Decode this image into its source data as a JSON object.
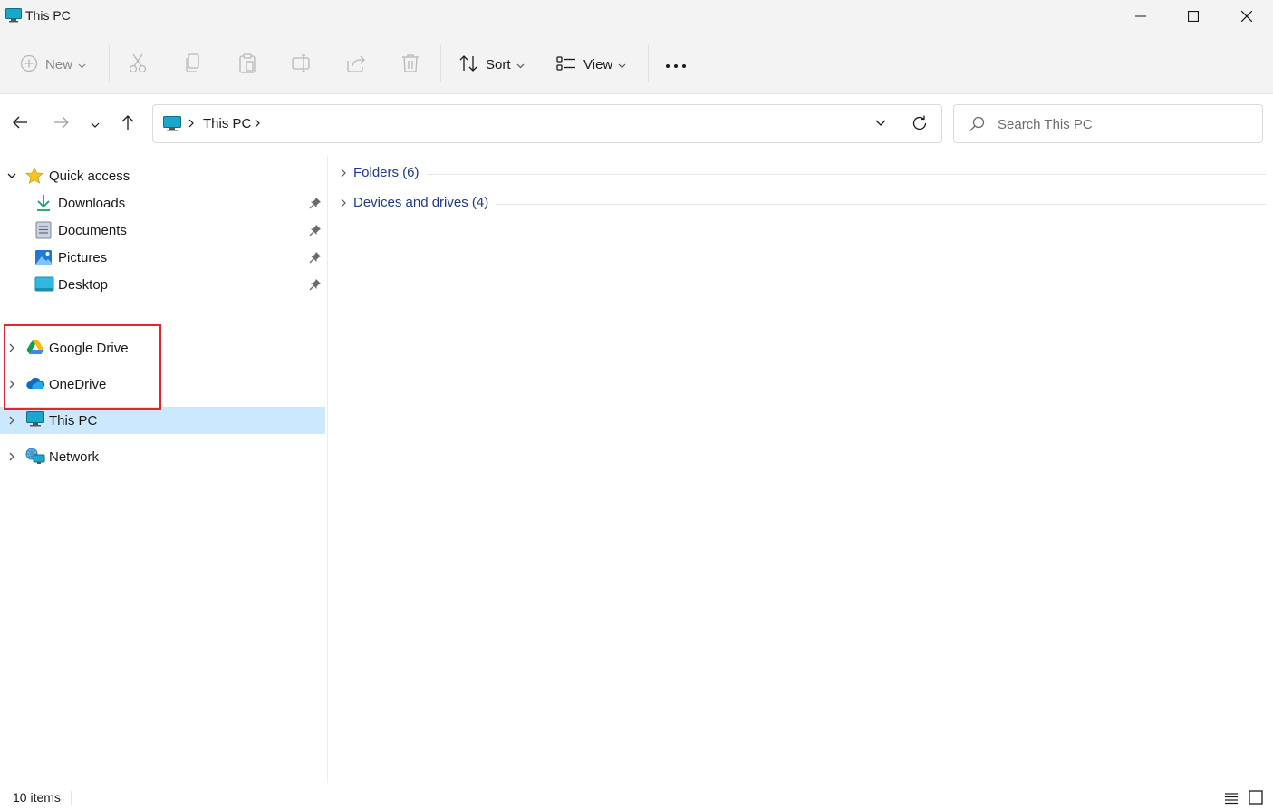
{
  "window": {
    "title": "This PC"
  },
  "toolbar": {
    "new_label": "New",
    "sort_label": "Sort",
    "view_label": "View"
  },
  "address": {
    "crumb": "This PC"
  },
  "search": {
    "placeholder": "Search This PC"
  },
  "sidebar": {
    "quick_access": "Quick access",
    "pinned": [
      {
        "label": "Downloads",
        "icon": "download-icon"
      },
      {
        "label": "Documents",
        "icon": "document-icon"
      },
      {
        "label": "Pictures",
        "icon": "pictures-icon"
      },
      {
        "label": "Desktop",
        "icon": "desktop-icon"
      }
    ],
    "google_drive": "Google Drive",
    "onedrive": "OneDrive",
    "this_pc": "This PC",
    "network": "Network"
  },
  "content": {
    "groups": [
      {
        "label": "Folders (6)"
      },
      {
        "label": "Devices and drives (4)"
      }
    ]
  },
  "status": {
    "item_count": "10 items"
  },
  "colors": {
    "accent": "#0078d4",
    "selection": "#cce8ff",
    "highlight_box": "#e0262f",
    "group_label": "#1e3a8a"
  }
}
